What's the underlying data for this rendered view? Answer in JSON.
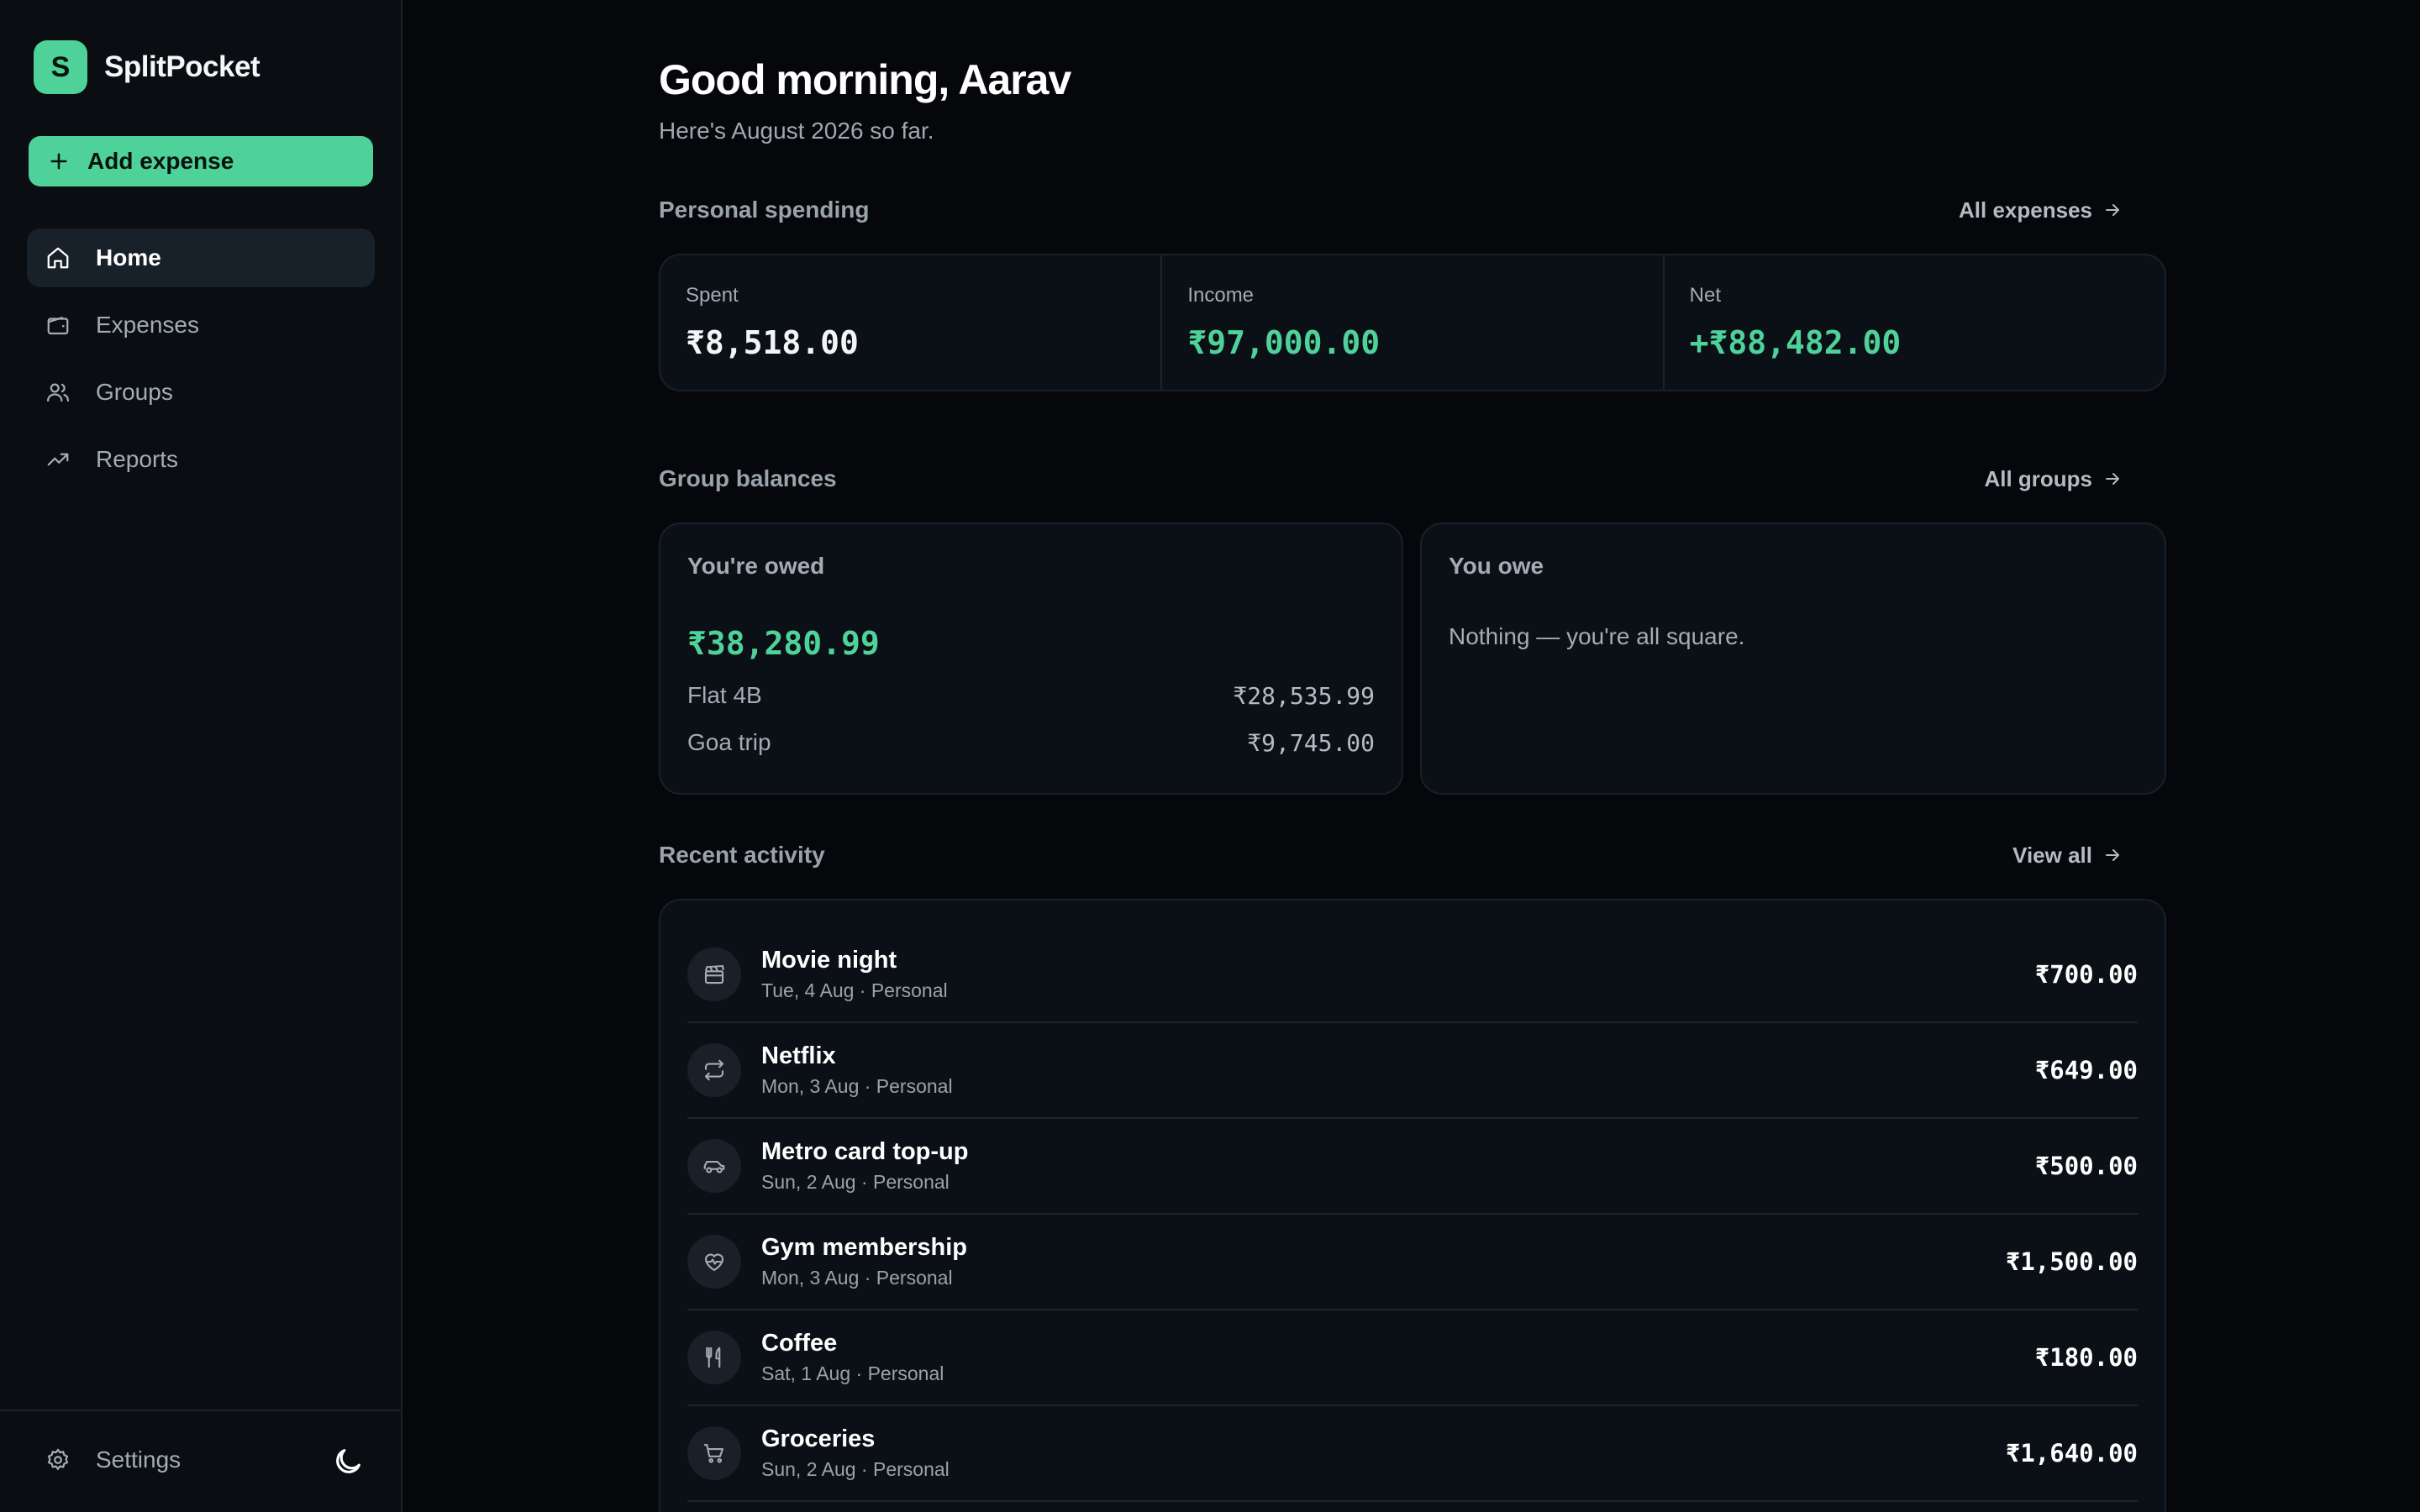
{
  "app": {
    "name": "SplitPocket",
    "logo_letter": "S"
  },
  "sidebar": {
    "add_label": "Add expense",
    "items": [
      {
        "label": "Home",
        "icon": "home-icon",
        "active": true
      },
      {
        "label": "Expenses",
        "icon": "wallet-icon",
        "active": false
      },
      {
        "label": "Groups",
        "icon": "users-icon",
        "active": false
      },
      {
        "label": "Reports",
        "icon": "trending-up-icon",
        "active": false
      }
    ],
    "settings_label": "Settings"
  },
  "header": {
    "greeting": "Good morning, Aarav",
    "subtitle": "Here's August 2026 so far."
  },
  "personal": {
    "title": "Personal spending",
    "link": "All expenses",
    "stats": [
      {
        "label": "Spent",
        "value": "₹8,518.00"
      },
      {
        "label": "Income",
        "value": "₹97,000.00"
      },
      {
        "label": "Net",
        "value": "+₹88,482.00"
      }
    ]
  },
  "groups": {
    "title": "Group balances",
    "link": "All groups",
    "owed": {
      "title": "You're owed",
      "total": "₹38,280.99",
      "rows": [
        {
          "name": "Flat 4B",
          "amount": "₹28,535.99"
        },
        {
          "name": "Goa trip",
          "amount": "₹9,745.00"
        }
      ]
    },
    "owe": {
      "title": "You owe",
      "empty": "Nothing — you're all square."
    }
  },
  "activity": {
    "title": "Recent activity",
    "link": "View all",
    "items": [
      {
        "name": "Movie night",
        "meta": "Tue, 4 Aug · Personal",
        "amount": "₹700.00",
        "icon": "clapperboard-icon"
      },
      {
        "name": "Netflix",
        "meta": "Mon, 3 Aug · Personal",
        "amount": "₹649.00",
        "icon": "repeat-icon"
      },
      {
        "name": "Metro card top-up",
        "meta": "Sun, 2 Aug · Personal",
        "amount": "₹500.00",
        "icon": "car-icon"
      },
      {
        "name": "Gym membership",
        "meta": "Mon, 3 Aug · Personal",
        "amount": "₹1,500.00",
        "icon": "heart-pulse-icon"
      },
      {
        "name": "Coffee",
        "meta": "Sat, 1 Aug · Personal",
        "amount": "₹180.00",
        "icon": "utensils-icon"
      },
      {
        "name": "Groceries",
        "meta": "Sun, 2 Aug · Personal",
        "amount": "₹1,640.00",
        "icon": "cart-icon"
      }
    ]
  },
  "colors": {
    "accent": "#4fd19a",
    "background": "#05070a",
    "sidebar": "#0a0e13",
    "card": "#0b1016"
  }
}
